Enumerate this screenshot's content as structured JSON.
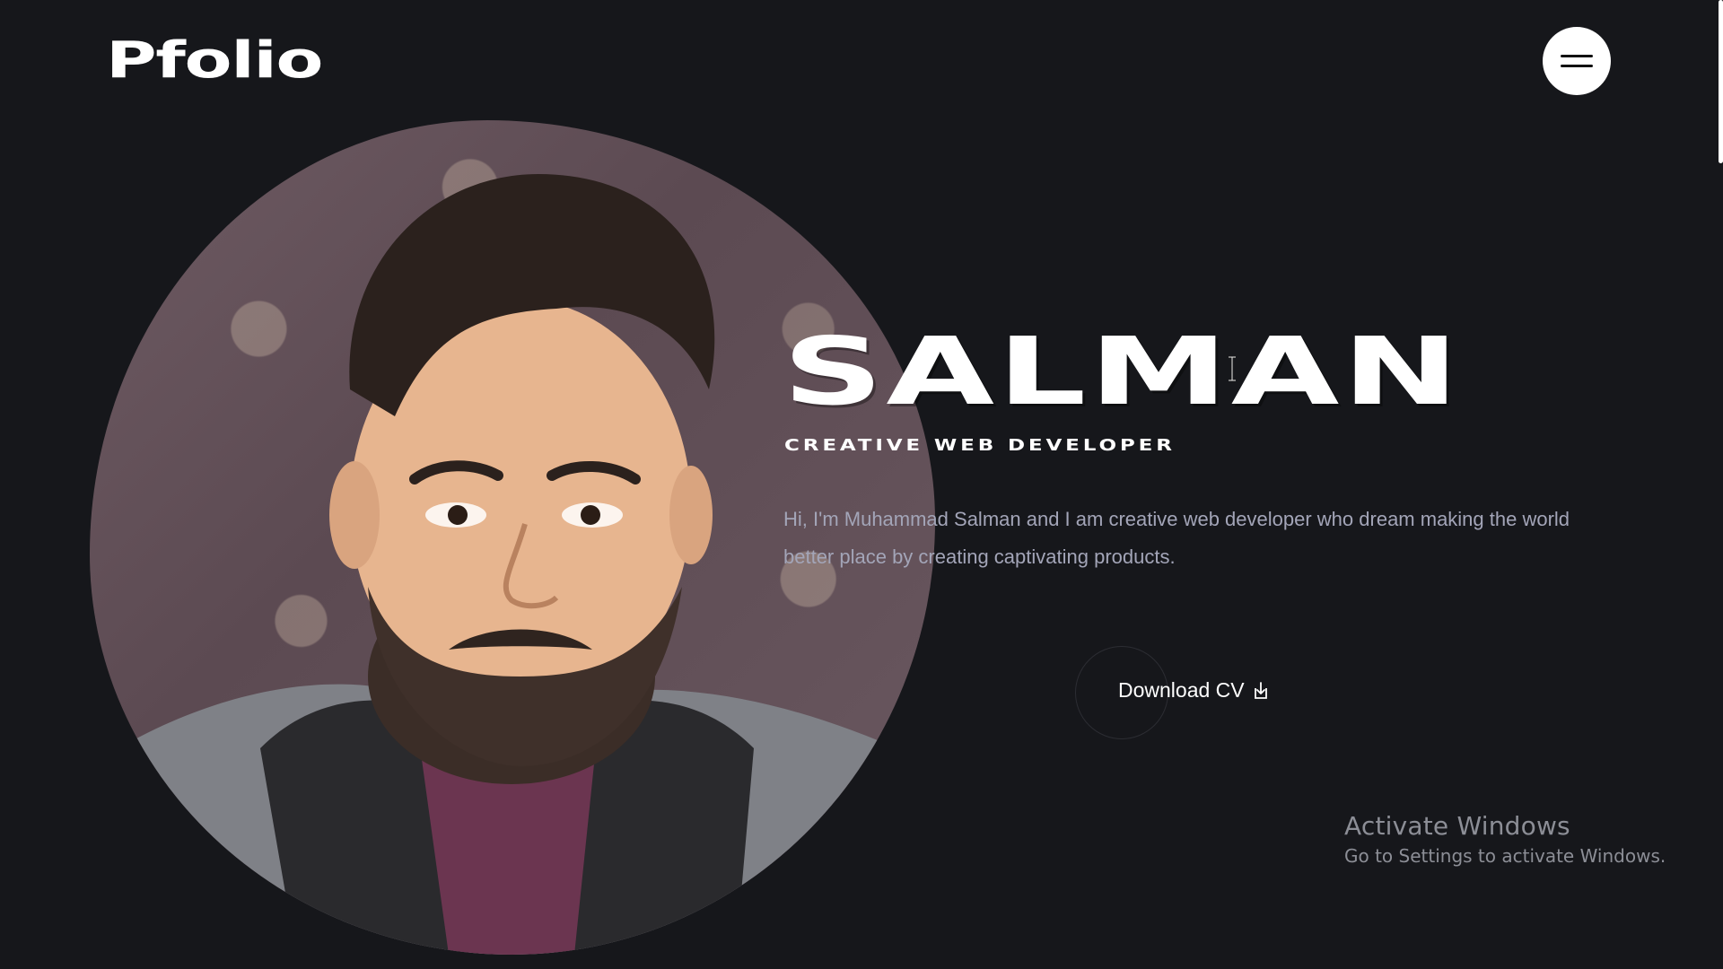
{
  "header": {
    "brand": "Pfolio",
    "menu_icon": "hamburger-menu-icon"
  },
  "hero": {
    "name": "SALMAN",
    "role": "CREATIVE WEB DEVELOPER",
    "description": "Hi, I'm Muhammad Salman and I am creative web developer who dream making the world better place by creating captivating products.",
    "download_label": "Download CV",
    "download_icon": "download-icon",
    "portrait_alt": "portrait photo"
  },
  "watermark": {
    "title": "Activate Windows",
    "subtitle": "Go to Settings to activate Windows."
  },
  "colors": {
    "background": "#16171b",
    "text": "#ffffff",
    "muted_text": "#a3a5b8",
    "watermark": "#8c8e96"
  }
}
